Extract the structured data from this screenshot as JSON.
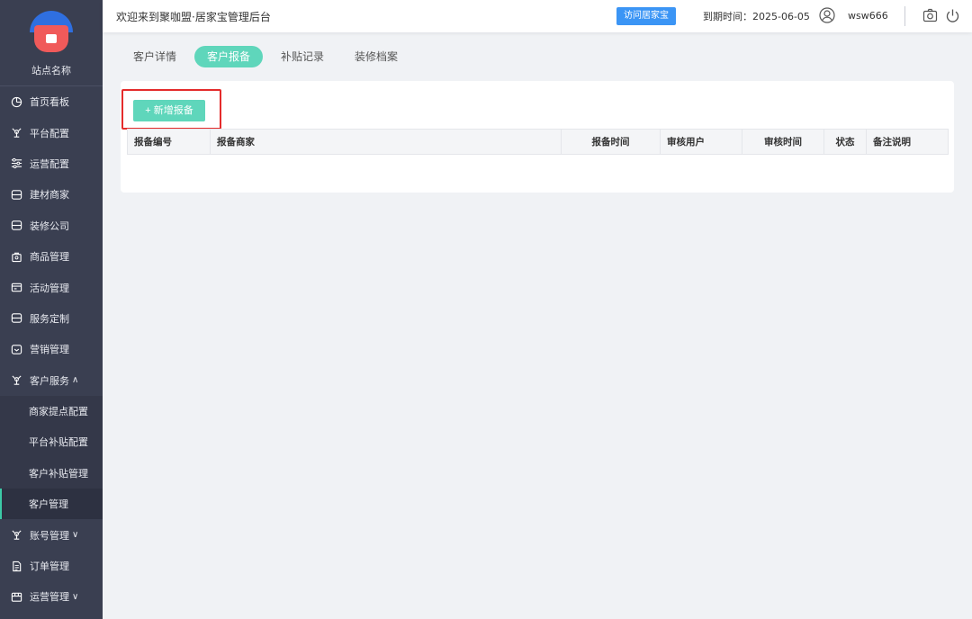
{
  "sidebar": {
    "site_name": "站点名称",
    "items": [
      {
        "label": "首页看板",
        "icon": "dashboard-icon"
      },
      {
        "label": "平台配置",
        "icon": "platform-icon"
      },
      {
        "label": "运营配置",
        "icon": "sliders-icon"
      },
      {
        "label": "建材商家",
        "icon": "shop-icon"
      },
      {
        "label": "装修公司",
        "icon": "company-icon"
      },
      {
        "label": "商品管理",
        "icon": "goods-icon"
      },
      {
        "label": "活动管理",
        "icon": "activity-icon"
      },
      {
        "label": "服务定制",
        "icon": "service-icon"
      },
      {
        "label": "营销管理",
        "icon": "marketing-icon"
      },
      {
        "label": "客户服务",
        "icon": "customer-icon",
        "arrow": "∧"
      }
    ],
    "sub_items": [
      {
        "label": "商家提点配置"
      },
      {
        "label": "平台补贴配置"
      },
      {
        "label": "客户补贴管理"
      },
      {
        "label": "客户管理",
        "active": true
      }
    ],
    "bottom_items": [
      {
        "label": "账号管理",
        "icon": "account-icon",
        "arrow": "∨"
      },
      {
        "label": "订单管理",
        "icon": "order-icon"
      },
      {
        "label": "运营管理",
        "icon": "operation-icon",
        "arrow": "∨"
      }
    ]
  },
  "header": {
    "title": "欢迎来到聚咖盟·居家宝管理后台",
    "visit_button": "访问居家宝",
    "expire_text": "到期时间：2025-06-05",
    "username": "wsw666"
  },
  "tabs": [
    {
      "label": "客户详情",
      "active": false
    },
    {
      "label": "客户报备",
      "active": true
    },
    {
      "label": "补贴记录",
      "active": false
    },
    {
      "label": "装修档案",
      "active": false
    }
  ],
  "main": {
    "add_button": "+ 新增报备",
    "table_headers": [
      "报备编号",
      "报备商家",
      "报备时间",
      "审核用户",
      "审核时间",
      "状态",
      "备注说明"
    ]
  },
  "colors": {
    "sidebar_bg": "#3a3f51",
    "accent": "#5fd6bb",
    "visit_button": "#3b95f5",
    "highlight_border": "#e42b2b"
  }
}
